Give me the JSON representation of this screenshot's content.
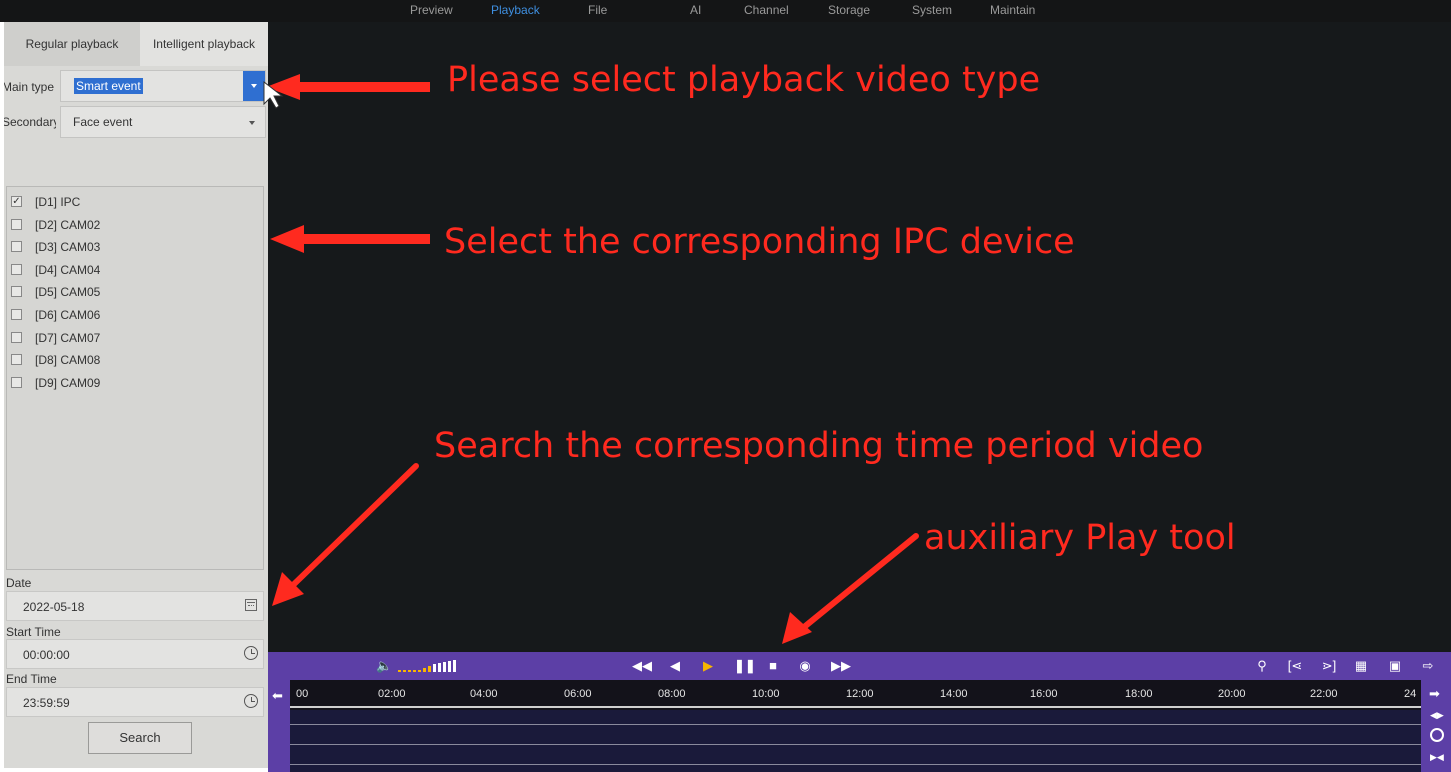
{
  "nav": {
    "items": [
      "Preview",
      "Playback",
      "File",
      "AI",
      "Channel",
      "Storage",
      "System",
      "Maintain"
    ],
    "active": "Playback",
    "active_color": "#3f8fe0"
  },
  "tabs": {
    "regular": "Regular playback",
    "intelligent": "Intelligent playback"
  },
  "form": {
    "main_type_label": "Main type",
    "main_type_value": "Smart event",
    "secondary_label": "Secondary",
    "secondary_value": "Face event"
  },
  "devices": [
    {
      "label": "[D1] IPC",
      "checked": true
    },
    {
      "label": "[D2] CAM02",
      "checked": false
    },
    {
      "label": "[D3] CAM03",
      "checked": false
    },
    {
      "label": "[D4] CAM04",
      "checked": false
    },
    {
      "label": "[D5] CAM05",
      "checked": false
    },
    {
      "label": "[D6] CAM06",
      "checked": false
    },
    {
      "label": "[D7] CAM07",
      "checked": false
    },
    {
      "label": "[D8] CAM08",
      "checked": false
    },
    {
      "label": "[D9] CAM09",
      "checked": false
    }
  ],
  "date": {
    "label": "Date",
    "value": "2022-05-18"
  },
  "start_time": {
    "label": "Start Time",
    "value": "00:00:00"
  },
  "end_time": {
    "label": "End Time",
    "value": "23:59:59"
  },
  "search_label": "Search",
  "annotations": {
    "type": "Please select playback video type",
    "device": "Select the corresponding IPC device",
    "time": "Search the corresponding time period video",
    "tool": "auxiliary Play tool",
    "color": "#ff2a1f"
  },
  "timeline_labels": [
    "00",
    "02:00",
    "04:00",
    "06:00",
    "08:00",
    "10:00",
    "12:00",
    "14:00",
    "16:00",
    "18:00",
    "20:00",
    "22:00",
    "24"
  ],
  "colors": {
    "toolbar": "#5c3fa6",
    "accent": "#f7b500",
    "selection": "#2f6fd1"
  }
}
